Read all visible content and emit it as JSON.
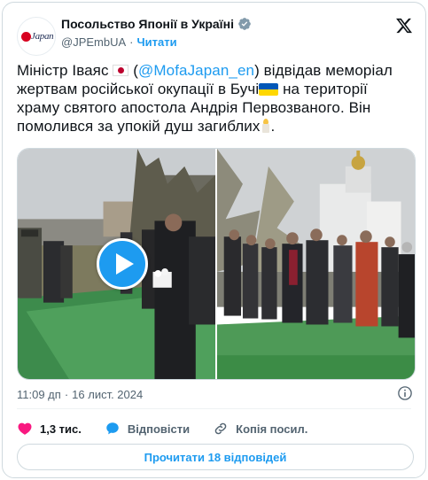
{
  "tweet": {
    "author": {
      "display_name": "Посольство Японії в Україні",
      "handle": "@JPEmbUA",
      "separator": "·",
      "follow_label": "Читати",
      "avatar_text": "Japan",
      "verified": true
    },
    "text": {
      "part1": "Міністр Іваяc",
      "open_paren": " (",
      "mention": "@MofaJapan_en",
      "part2": ") відвідав меморіал жертвам російської окупації в Бучі",
      "part3": " на території храму святого апостола Андрія Первозваного. Він помолився за упокій душ загиблих",
      "part4": "."
    },
    "media": {
      "icons": [
        "play-icon"
      ]
    },
    "timestamp": {
      "time": "11:09 дп",
      "dot": "·",
      "date": "16 лист. 2024"
    },
    "actions": {
      "likes_count": "1,3 тис.",
      "reply_label": "Відповісти",
      "copy_label": "Копія посил."
    },
    "read_button_label": "Прочитати 18 відповідей"
  },
  "colors": {
    "accent": "#1d9bf0",
    "like": "#f91880",
    "text": "#0f1419",
    "muted": "#536471",
    "border": "#cfd9de"
  }
}
